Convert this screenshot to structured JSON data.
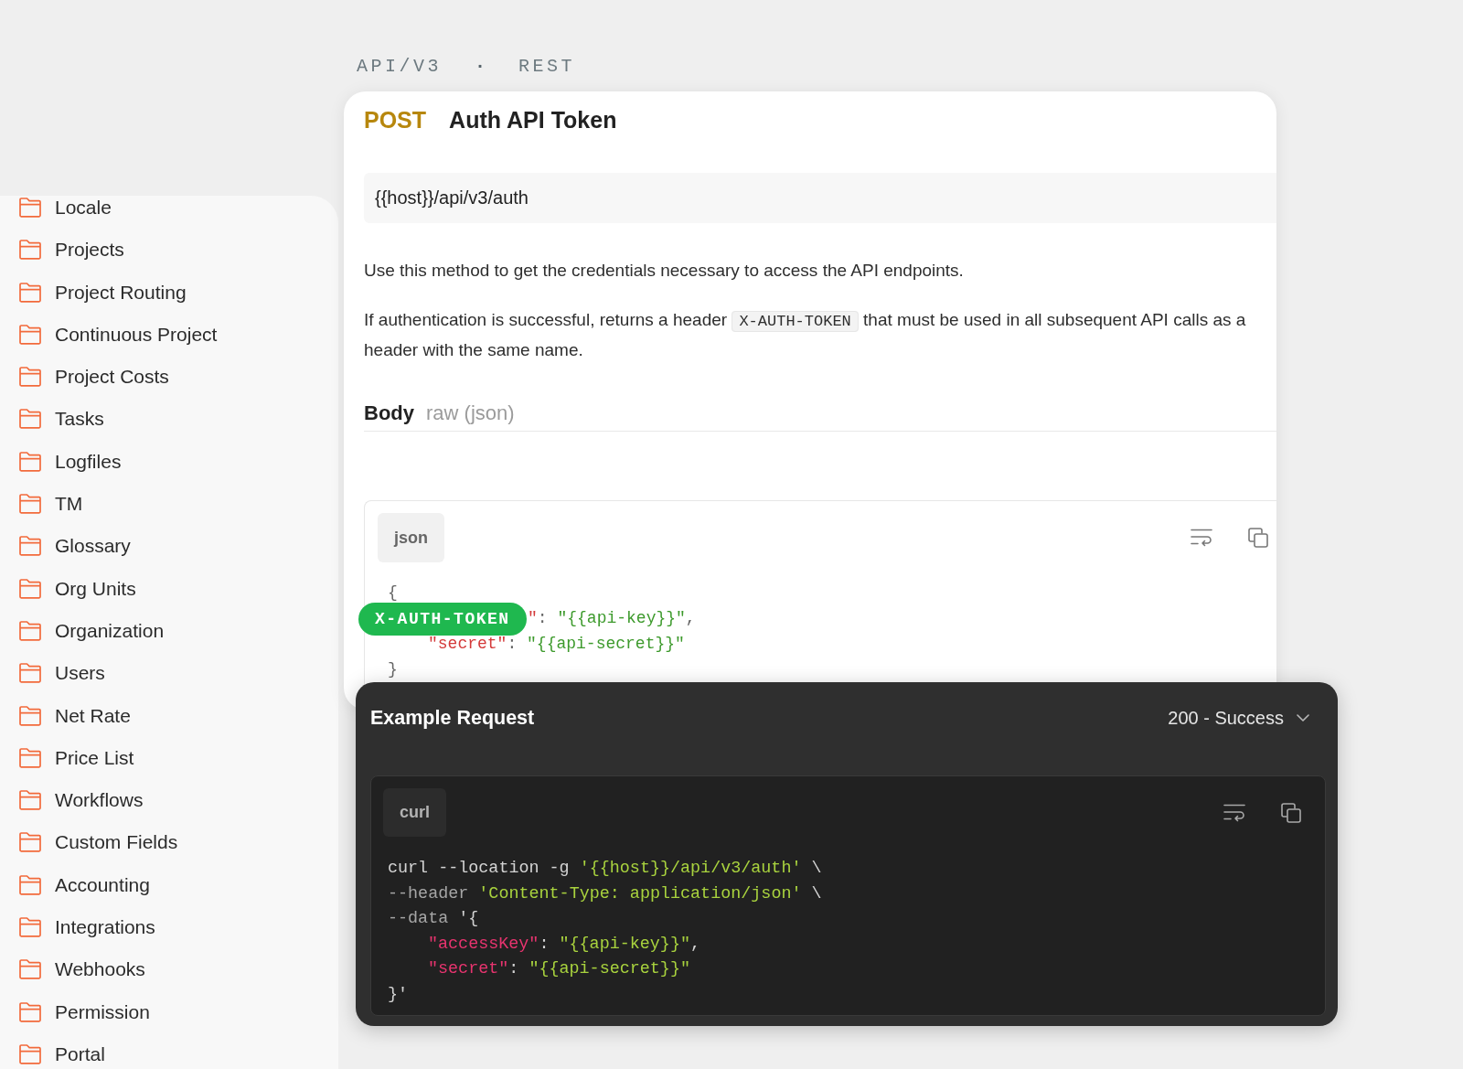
{
  "breadcrumb": [
    {
      "kind": "segment",
      "text": "API/V3"
    },
    {
      "kind": "separator",
      "text": "·"
    },
    {
      "kind": "segment",
      "text": "REST"
    }
  ],
  "sidebar": {
    "items": [
      "Locale",
      "Projects",
      "Project Routing",
      "Continuous Project",
      "Project Costs",
      "Tasks",
      "Logfiles",
      "TM",
      "Glossary",
      "Org Units",
      "Organization",
      "Users",
      "Net Rate",
      "Price List",
      "Workflows",
      "Custom Fields",
      "Accounting",
      "Integrations",
      "Webhooks",
      "Permission",
      "Portal"
    ]
  },
  "endpoint": {
    "method": "POST",
    "title": "Auth API Token",
    "url": "{{host}}/api/v3/auth",
    "description": [
      [
        {
          "kind": "text",
          "text": "Use this method to get the credentials necessary to access the API endpoints."
        }
      ],
      [
        {
          "kind": "text",
          "text": "If authentication is successful, returns a header "
        },
        {
          "kind": "code",
          "text": "X-AUTH-TOKEN"
        },
        {
          "kind": "text",
          "text": " that must be used in all subsequent API calls as a header with the same name."
        }
      ]
    ],
    "body": {
      "label": "Body",
      "format": "raw (json)"
    },
    "code": {
      "language": "json",
      "badge": "X-AUTH-TOKEN",
      "lines": [
        {
          "kind": "plain",
          "tokens": [
            {
              "kind": "punct",
              "text": "{"
            }
          ]
        },
        {
          "kind": "partial",
          "tokens": [
            {
              "kind": "key",
              "text": "\""
            },
            {
              "kind": "punct",
              "text": ": "
            },
            {
              "kind": "string",
              "text": "\"{{api-key}}\""
            },
            {
              "kind": "punct",
              "text": ","
            }
          ]
        },
        {
          "kind": "indented",
          "tokens": [
            {
              "kind": "key",
              "text": "\"secret\""
            },
            {
              "kind": "punct",
              "text": ": "
            },
            {
              "kind": "string",
              "text": "\"{{api-secret}}\""
            }
          ]
        },
        {
          "kind": "plain",
          "tokens": [
            {
              "kind": "punct",
              "text": "}"
            }
          ]
        }
      ]
    }
  },
  "example": {
    "title": "Example Request",
    "status": "200 - Success",
    "code": {
      "language": "curl",
      "lines": [
        {
          "kind": "plain",
          "tokens": [
            {
              "kind": "plain",
              "text": "curl --location -g "
            },
            {
              "kind": "string",
              "text": "'{{host}}/api/v3/auth'"
            },
            {
              "kind": "plain",
              "text": " \\"
            }
          ]
        },
        {
          "kind": "plain",
          "tokens": [
            {
              "kind": "muted",
              "text": "--header "
            },
            {
              "kind": "string",
              "text": "'Content-Type: application/json'"
            },
            {
              "kind": "plain",
              "text": " \\"
            }
          ]
        },
        {
          "kind": "plain",
          "tokens": [
            {
              "kind": "muted",
              "text": "--data "
            },
            {
              "kind": "plain",
              "text": "'{"
            }
          ]
        },
        {
          "kind": "indented",
          "tokens": [
            {
              "kind": "key",
              "text": "\"accessKey\""
            },
            {
              "kind": "punct",
              "text": ": "
            },
            {
              "kind": "string",
              "text": "\"{{api-key}}\""
            },
            {
              "kind": "punct",
              "text": ","
            }
          ]
        },
        {
          "kind": "indented",
          "tokens": [
            {
              "kind": "key",
              "text": "\"secret\""
            },
            {
              "kind": "punct",
              "text": ": "
            },
            {
              "kind": "string",
              "text": "\"{{api-secret}}\""
            }
          ]
        },
        {
          "kind": "plain",
          "tokens": [
            {
              "kind": "plain",
              "text": "}'"
            }
          ]
        }
      ]
    }
  }
}
